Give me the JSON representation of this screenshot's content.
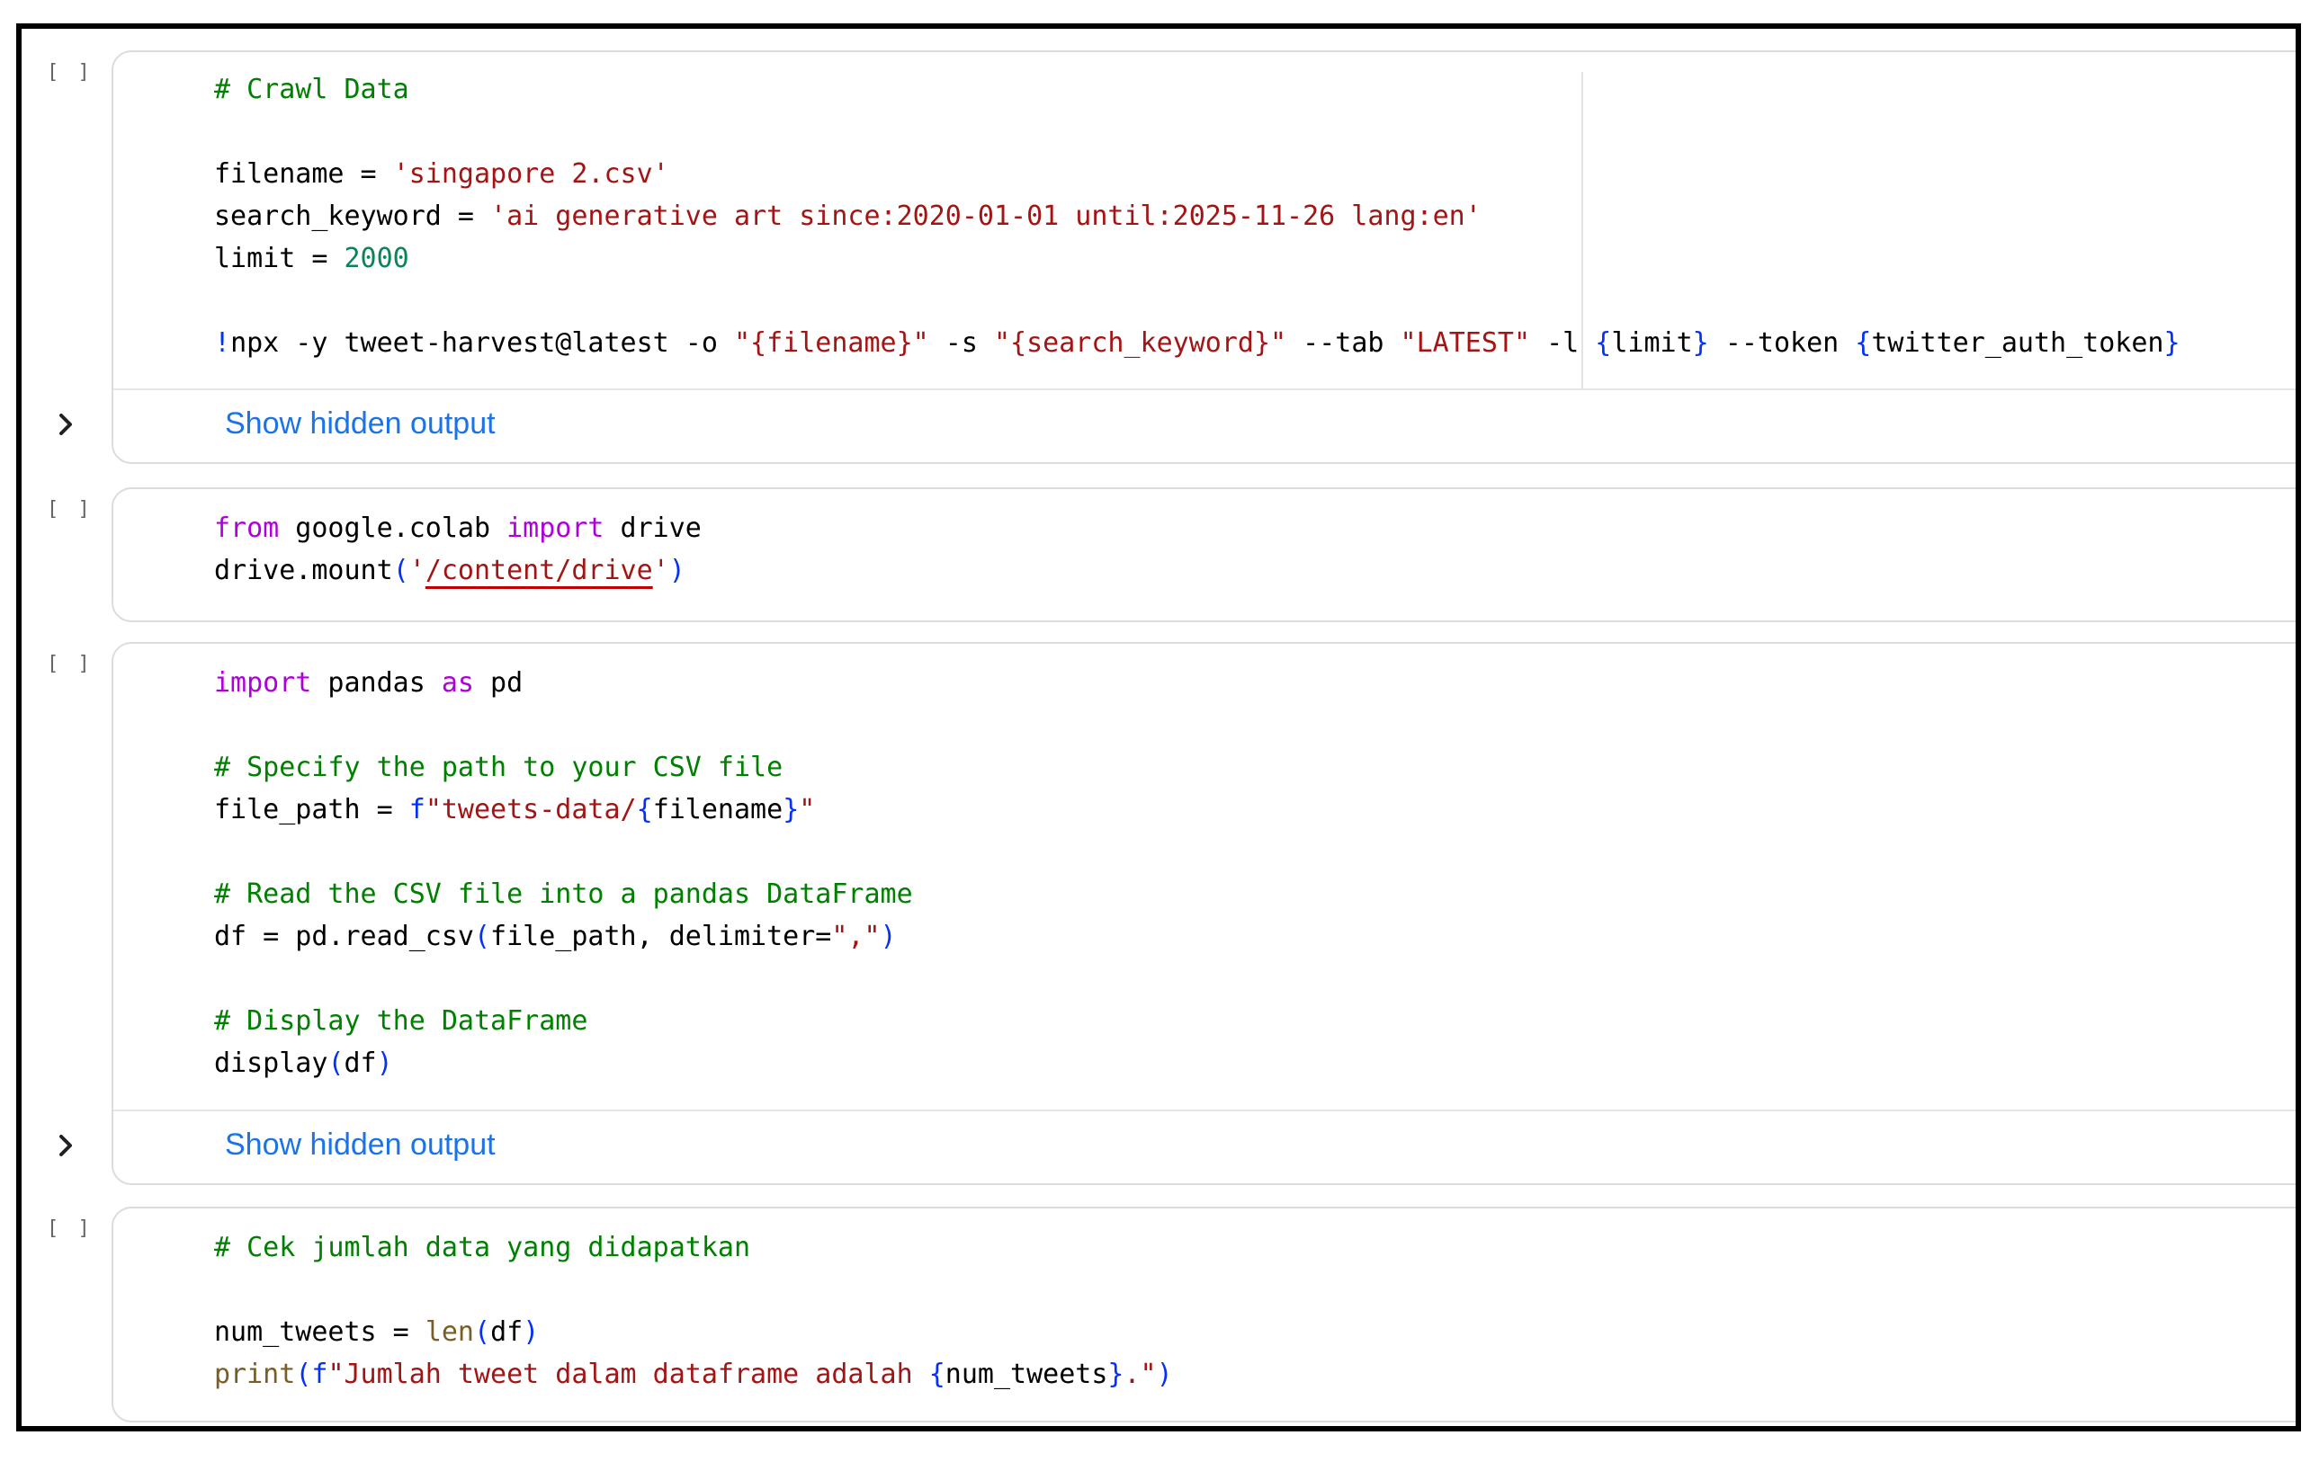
{
  "cells": [
    {
      "run_label": "[ ]",
      "lines": [
        [
          {
            "t": "# Crawl Data",
            "c": "comment"
          }
        ],
        [],
        [
          {
            "t": "filename = "
          },
          {
            "t": "'singapore 2.csv'",
            "c": "string"
          }
        ],
        [
          {
            "t": "search_keyword = "
          },
          {
            "t": "'ai generative art since:2020-01-01 until:2025-11-26 lang:en'",
            "c": "string"
          }
        ],
        [
          {
            "t": "limit = "
          },
          {
            "t": "2000",
            "c": "number"
          }
        ],
        [],
        [
          {
            "t": "!",
            "c": "brace"
          },
          {
            "t": "npx -y tweet-harvest@latest -o "
          },
          {
            "t": "\"{filename}\"",
            "c": "string"
          },
          {
            "t": " -s "
          },
          {
            "t": "\"{search_keyword}\"",
            "c": "string"
          },
          {
            "t": " --tab "
          },
          {
            "t": "\"LATEST\"",
            "c": "string"
          },
          {
            "t": " -l "
          },
          {
            "t": "{",
            "c": "brace"
          },
          {
            "t": "limit"
          },
          {
            "t": "}",
            "c": "brace"
          },
          {
            "t": " --token "
          },
          {
            "t": "{",
            "c": "brace"
          },
          {
            "t": "twitter_auth_token"
          },
          {
            "t": "}",
            "c": "brace"
          }
        ]
      ],
      "output_label": "Show hidden output"
    },
    {
      "run_label": "[ ]",
      "lines": [
        [
          {
            "t": "from",
            "c": "keyword"
          },
          {
            "t": " google.colab "
          },
          {
            "t": "import",
            "c": "keyword"
          },
          {
            "t": " drive"
          }
        ],
        [
          {
            "t": "drive.mount"
          },
          {
            "t": "(",
            "c": "brace"
          },
          {
            "t": "'",
            "c": "string"
          },
          {
            "t": "/content/drive",
            "c": "string",
            "s": true
          },
          {
            "t": "'",
            "c": "string"
          },
          {
            "t": ")",
            "c": "brace"
          }
        ]
      ]
    },
    {
      "run_label": "[ ]",
      "lines": [
        [
          {
            "t": "import",
            "c": "keyword"
          },
          {
            "t": " pandas "
          },
          {
            "t": "as",
            "c": "keyword"
          },
          {
            "t": " pd"
          }
        ],
        [],
        [
          {
            "t": "# Specify the path to your CSV file",
            "c": "comment"
          }
        ],
        [
          {
            "t": "file_path = "
          },
          {
            "t": "f",
            "c": "brace"
          },
          {
            "t": "\"tweets-data/",
            "c": "string"
          },
          {
            "t": "{",
            "c": "brace"
          },
          {
            "t": "filename"
          },
          {
            "t": "}",
            "c": "brace"
          },
          {
            "t": "\"",
            "c": "string"
          }
        ],
        [],
        [
          {
            "t": "# Read the CSV file into a pandas DataFrame",
            "c": "comment"
          }
        ],
        [
          {
            "t": "df = pd.read_csv"
          },
          {
            "t": "(",
            "c": "brace"
          },
          {
            "t": "file_path, delimiter="
          },
          {
            "t": "\",\"",
            "c": "string"
          },
          {
            "t": ")",
            "c": "brace"
          }
        ],
        [],
        [
          {
            "t": "# Display the DataFrame",
            "c": "comment"
          }
        ],
        [
          {
            "t": "display"
          },
          {
            "t": "(",
            "c": "brace"
          },
          {
            "t": "df"
          },
          {
            "t": ")",
            "c": "brace"
          }
        ]
      ],
      "output_label": "Show hidden output"
    },
    {
      "run_label": "[ ]",
      "lines": [
        [
          {
            "t": "# Cek jumlah data yang didapatkan",
            "c": "comment"
          }
        ],
        [],
        [
          {
            "t": "num_tweets = "
          },
          {
            "t": "len",
            "c": "func"
          },
          {
            "t": "(",
            "c": "brace"
          },
          {
            "t": "df"
          },
          {
            "t": ")",
            "c": "brace"
          }
        ],
        [
          {
            "t": "print",
            "c": "func"
          },
          {
            "t": "(",
            "c": "brace"
          },
          {
            "t": "f",
            "c": "brace"
          },
          {
            "t": "\"Jumlah tweet dalam dataframe adalah ",
            "c": "string"
          },
          {
            "t": "{",
            "c": "brace"
          },
          {
            "t": "num_tweets"
          },
          {
            "t": "}",
            "c": "brace"
          },
          {
            "t": ".\"",
            "c": "string"
          },
          {
            "t": ")",
            "c": "brace"
          }
        ]
      ]
    }
  ]
}
